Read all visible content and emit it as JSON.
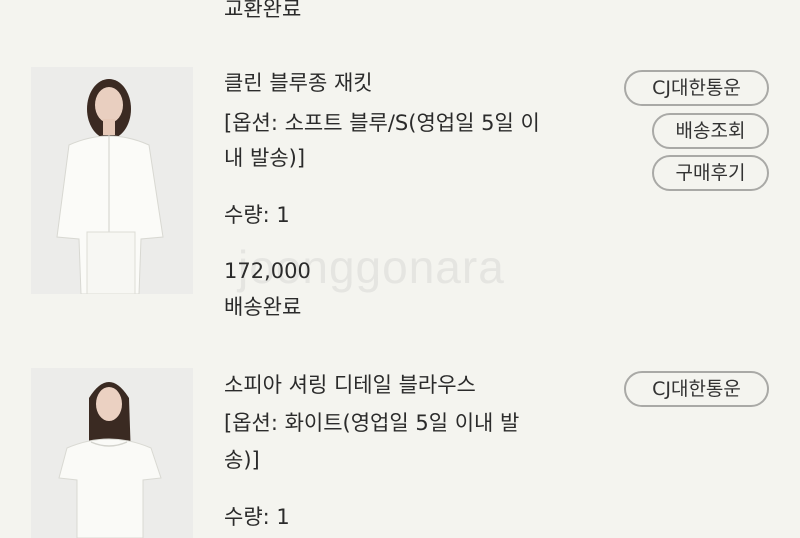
{
  "top_status": "교환완료",
  "watermark": "joonggonara",
  "orders": [
    {
      "name": "클린 블루종 재킷",
      "option_line1": "[옵션: 소프트 블루/S(영업일 5일 이",
      "option_line2": "내 발송)]",
      "quantity": "수량: 1",
      "price": "172,000",
      "status": "배송완료",
      "buttons": {
        "courier": "CJ대한통운",
        "track": "배송조회",
        "review": "구매후기"
      }
    },
    {
      "name": "소피아 셔링 디테일 블라우스",
      "option_line1": "[옵션: 화이트(영업일 5일 이내 발",
      "option_line2": "송)]",
      "quantity": "수량: 1",
      "buttons": {
        "courier": "CJ대한통운"
      }
    }
  ]
}
